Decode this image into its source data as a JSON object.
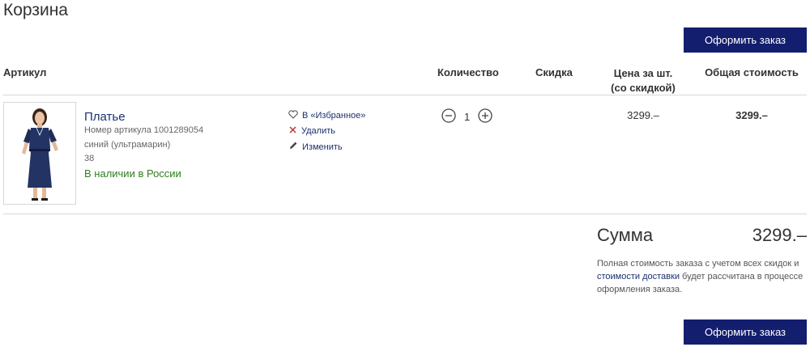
{
  "page": {
    "title": "Корзина"
  },
  "actions": {
    "checkout_label": "Оформить заказ"
  },
  "table": {
    "headers": {
      "article": "Артикул",
      "quantity": "Количество",
      "discount": "Скидка",
      "unit_price_line1": "Цена за шт.",
      "unit_price_line2": "(со скидкой)",
      "total": "Общая стоимость"
    }
  },
  "item": {
    "name": "Платье",
    "sku_text": "Номер артикула 1001289054",
    "color": "синий (ультрамарин)",
    "size": "38",
    "stock": "В наличии в России",
    "favorite_label": "В «Избранное»",
    "delete_label": "Удалить",
    "edit_label": "Изменить",
    "quantity": "1",
    "discount": "",
    "unit_price": "3299.–",
    "total": "3299.–"
  },
  "summary": {
    "label": "Сумма",
    "value": "3299.–",
    "note_part1": "Полная стоимость заказа с учетом всех скидок и ",
    "note_link": "стоимости доставки",
    "note_part2": " будет рассчитана в процессе оформления заказа."
  },
  "colors": {
    "brand": "#141e6e",
    "link": "#1b2f6e",
    "stock_green": "#2e7d1e",
    "delete_red": "#c0392b"
  },
  "icons": [
    "heart-icon",
    "close-icon",
    "pencil-icon",
    "minus-icon",
    "plus-icon"
  ]
}
